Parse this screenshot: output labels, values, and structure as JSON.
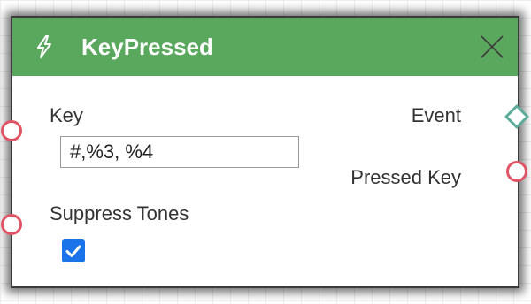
{
  "node": {
    "title": "KeyPressed",
    "icon": "lightning-bolt-icon",
    "header_color": "#5aa75e"
  },
  "inputs": {
    "key": {
      "label": "Key",
      "value": "#,%3, %4"
    },
    "suppress_tones": {
      "label": "Suppress Tones",
      "checked": true
    }
  },
  "outputs": {
    "event": {
      "label": "Event"
    },
    "pressed_key": {
      "label": "Pressed Key"
    }
  },
  "colors": {
    "port_input": "#e05565",
    "port_event": "#5aab9a",
    "checkbox": "#1a73e8"
  }
}
